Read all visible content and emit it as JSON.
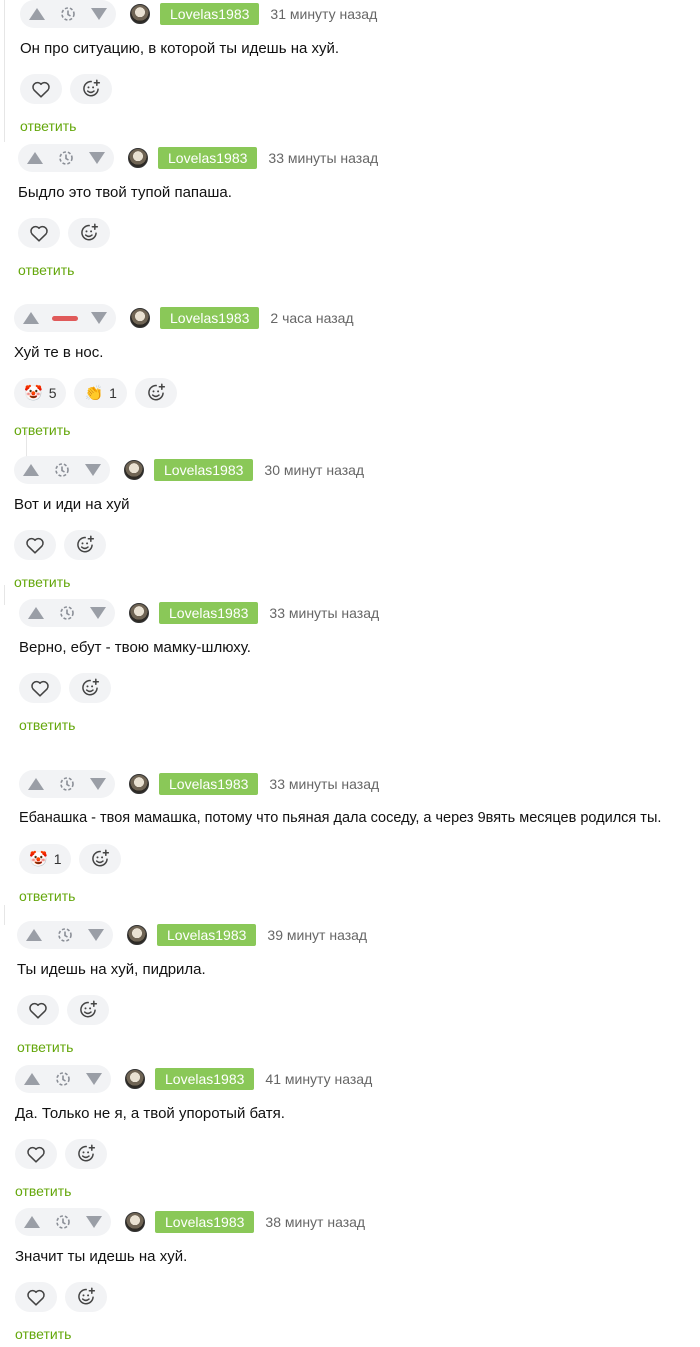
{
  "labels": {
    "reply": "ответить"
  },
  "colors": {
    "username_bg": "#8ac858",
    "reply": "#64a70b",
    "negative_rating": "#e05a5a"
  },
  "comments": [
    {
      "username": "Lovelas1983",
      "time": "31 минуту назад",
      "text": "Он про ситуацию, в которой ты идешь на хуй."
    },
    {
      "username": "Lovelas1983",
      "time": "33 минуты назад",
      "text": "Быдло это твой тупой папаша."
    },
    {
      "username": "Lovelas1983",
      "time": "2 часа назад",
      "text": "Хуй те в нос.",
      "reactions": [
        {
          "icon": "clown-face-icon",
          "count": "5"
        },
        {
          "icon": "clapping-hands-icon",
          "count": "1"
        }
      ]
    },
    {
      "username": "Lovelas1983",
      "time": "30 минут назад",
      "text": "Вот и иди на хуй"
    },
    {
      "username": "Lovelas1983",
      "time": "33 минуты назад",
      "text": "Верно, ебут - твою мамку-шлюху."
    },
    {
      "username": "Lovelas1983",
      "time": "33 минуты назад",
      "text": "Ебанашка - твоя мамашка, потому что пьяная дала соседу, а через 9вять месяцев родился ты.",
      "reactions": [
        {
          "icon": "clown-face-icon",
          "count": "1"
        }
      ]
    },
    {
      "username": "Lovelas1983",
      "time": "39 минут назад",
      "text": "Ты идешь на хуй, пидрила."
    },
    {
      "username": "Lovelas1983",
      "time": "41 минуту назад",
      "text": "Да. Только не я, а твой упоротый батя."
    },
    {
      "username": "Lovelas1983",
      "time": "38 минут назад",
      "text": "Значит ты идешь на хуй."
    }
  ]
}
